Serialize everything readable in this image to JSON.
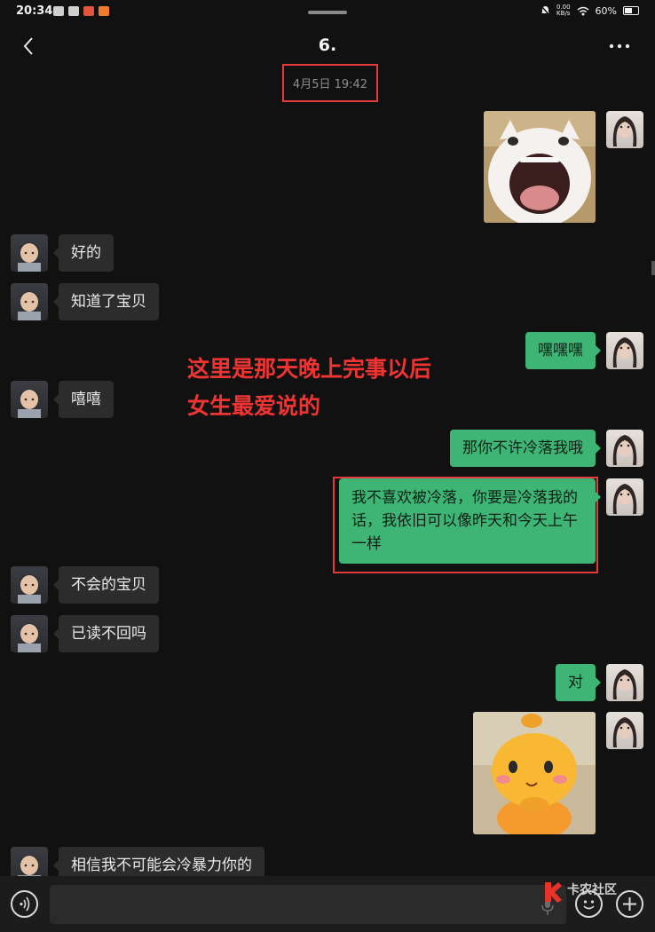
{
  "status_bar": {
    "time": "20:34",
    "net_speed_value": "0.00",
    "net_speed_unit": "KB/s",
    "battery_percent": "60%",
    "battery_level": 0.6
  },
  "header": {
    "title": "6."
  },
  "timestamp": "4月5日 19:42",
  "messages": [
    {
      "side": "out",
      "type": "sticker",
      "sticker": "screaming-cat-sticker"
    },
    {
      "side": "in",
      "type": "text",
      "text": "好的"
    },
    {
      "side": "in",
      "type": "text",
      "text": "知道了宝贝"
    },
    {
      "side": "out",
      "type": "text",
      "text": "嘿嘿嘿"
    },
    {
      "side": "in",
      "type": "text",
      "text": "嘻嘻"
    },
    {
      "side": "out",
      "type": "text",
      "text": "那你不许冷落我哦"
    },
    {
      "side": "out",
      "type": "text",
      "text": "我不喜欢被冷落，你要是冷落我的话，我依旧可以像昨天和今天上午一样"
    },
    {
      "side": "in",
      "type": "text",
      "text": "不会的宝贝"
    },
    {
      "side": "in",
      "type": "text",
      "text": "已读不回吗"
    },
    {
      "side": "out",
      "type": "text",
      "text": "对"
    },
    {
      "side": "out",
      "type": "sticker",
      "sticker": "orange-cartoon-creature-sticker"
    },
    {
      "side": "in",
      "type": "text",
      "text": "相信我不可能会冷暴力你的"
    }
  ],
  "annotation": {
    "line1": "这里是那天晚上完事以后",
    "line2": "女生最爱说的",
    "color": "#ef3434"
  },
  "input_bar": {
    "placeholder": ""
  },
  "watermark": {
    "text": "卡农社区"
  },
  "colors": {
    "background": "#111111",
    "bubble_out": "#3eb575",
    "bubble_in": "#2c2c2c",
    "highlight": "#e63a3a"
  },
  "icons": [
    "back-icon",
    "more-icon",
    "voice-icon",
    "mic-icon",
    "emoji-icon",
    "plus-icon"
  ]
}
